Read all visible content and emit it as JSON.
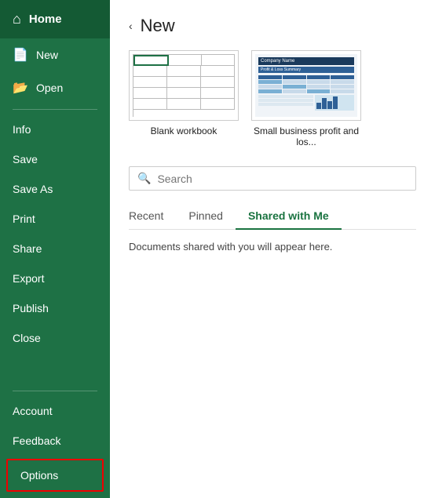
{
  "sidebar": {
    "home_label": "Home",
    "items": [
      {
        "id": "new",
        "label": "New",
        "icon": "📄"
      },
      {
        "id": "open",
        "label": "Open",
        "icon": "📂"
      },
      {
        "id": "info",
        "label": "Info",
        "icon": ""
      },
      {
        "id": "save",
        "label": "Save",
        "icon": ""
      },
      {
        "id": "save-as",
        "label": "Save As",
        "icon": ""
      },
      {
        "id": "print",
        "label": "Print",
        "icon": ""
      },
      {
        "id": "share",
        "label": "Share",
        "icon": ""
      },
      {
        "id": "export",
        "label": "Export",
        "icon": ""
      },
      {
        "id": "publish",
        "label": "Publish",
        "icon": ""
      },
      {
        "id": "close",
        "label": "Close",
        "icon": ""
      }
    ],
    "bottom_items": [
      {
        "id": "account",
        "label": "Account"
      },
      {
        "id": "feedback",
        "label": "Feedback"
      }
    ],
    "options_label": "Options"
  },
  "main": {
    "section_title": "New",
    "chevron": "›",
    "templates": [
      {
        "id": "blank",
        "label": "Blank workbook"
      },
      {
        "id": "business",
        "label": "Small business profit and los..."
      }
    ],
    "search": {
      "placeholder": "Search"
    },
    "tabs": [
      {
        "id": "recent",
        "label": "Recent",
        "active": false
      },
      {
        "id": "pinned",
        "label": "Pinned",
        "active": false
      },
      {
        "id": "shared",
        "label": "Shared with Me",
        "active": true
      }
    ],
    "shared_message": "Documents shared with you will appear here."
  }
}
